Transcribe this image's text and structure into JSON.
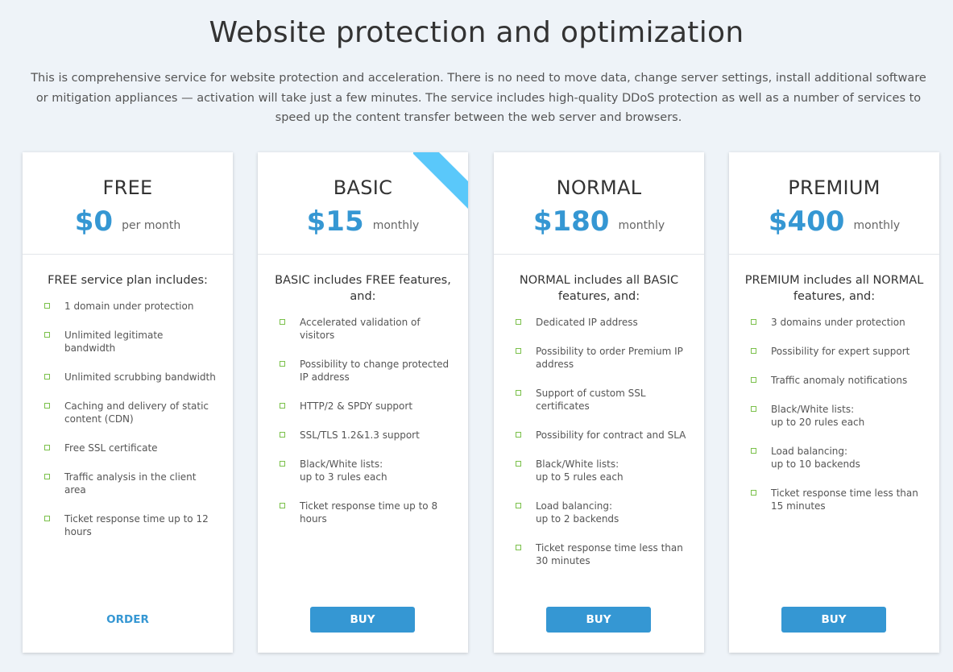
{
  "header": {
    "title": "Website protection and optimization",
    "intro": "This is comprehensive service for website protection and acceleration. There is no need to move data, change server settings, install additional software or mitigation appliances — activation will take just a few minutes. The service includes high-quality DDoS protection as well as a number of services to speed up the content transfer between the web server and browsers."
  },
  "colors": {
    "accent": "#3597d3",
    "ribbon": "#5ac8fa",
    "check": "#7ac04a",
    "background": "#eef3f8"
  },
  "icons": {
    "feature_bullet": "check-icon",
    "featured_marker": "ribbon-icon"
  },
  "plans": [
    {
      "name": "FREE",
      "price": "$0",
      "period": "per month",
      "includes": "FREE service plan includes:",
      "features": [
        "1 domain under protection",
        "Unlimited legitimate bandwidth",
        "Unlimited scrubbing bandwidth",
        "Caching and delivery of static content (CDN)",
        "Free SSL certificate",
        "Traffic analysis in the client area",
        "Ticket response time up to 12 hours"
      ],
      "action": "ORDER"
    },
    {
      "name": "BASIC",
      "price": "$15",
      "period": "monthly",
      "includes": "BASIC includes FREE features, and:",
      "features": [
        "Accelerated validation of visitors",
        "Possibility to change protected IP address",
        "HTTP/2 & SPDY support",
        "SSL/TLS 1.2&1.3 support",
        "Black/White lists:\nup to 3 rules each",
        "Ticket response time up to 8 hours"
      ],
      "action": "BUY"
    },
    {
      "name": "NORMAL",
      "price": "$180",
      "period": "monthly",
      "includes": "NORMAL includes all BASIC features, and:",
      "features": [
        "Dedicated IP address",
        "Possibility to order Premium IP address",
        "Support of custom SSL certificates",
        "Possibility for contract and SLA",
        "Black/White lists:\nup to 5 rules each",
        "Load balancing:\nup to 2 backends",
        "Ticket response time less than 30 minutes"
      ],
      "action": "BUY"
    },
    {
      "name": "PREMIUM",
      "price": "$400",
      "period": "monthly",
      "includes": "PREMIUM includes all NORMAL features, and:",
      "features": [
        "3 domains under protection",
        "Possibility for expert support",
        "Traffic anomaly notifications",
        "Black/White lists:\nup to 20 rules each",
        "Load balancing:\nup to 10 backends",
        "Ticket response time less than 15 minutes"
      ],
      "action": "BUY"
    }
  ]
}
